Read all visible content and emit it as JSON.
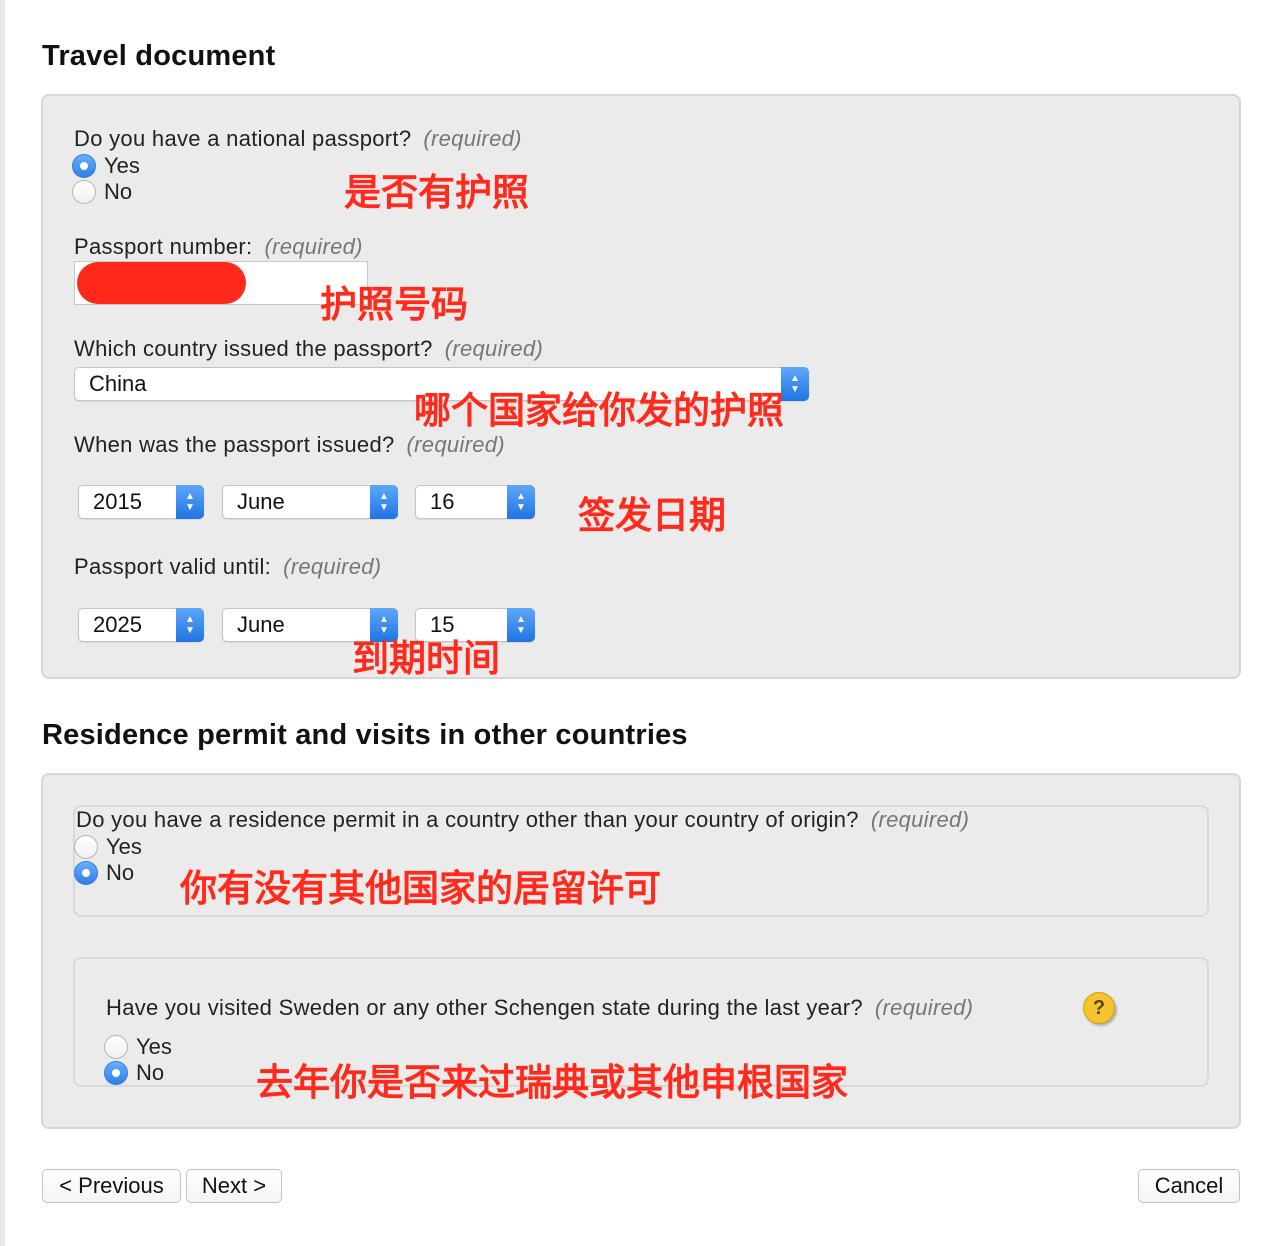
{
  "travel_document": {
    "title": "Travel document",
    "required_label": "(required)",
    "national_passport": {
      "question": "Do you have a national passport?",
      "yes": "Yes",
      "no": "No",
      "selected": "Yes",
      "annotation": "是否有护照"
    },
    "passport_number": {
      "question": "Passport number:",
      "annotation": "护照号码"
    },
    "issuing_country": {
      "question": "Which country issued the passport?",
      "value": "China",
      "annotation": "哪个国家给你发的护照"
    },
    "issue_date": {
      "question": "When was the passport issued?",
      "year": "2015",
      "month": "June",
      "day": "16",
      "annotation": "签发日期"
    },
    "valid_until": {
      "question": "Passport valid until:",
      "year": "2025",
      "month": "June",
      "day": "15",
      "annotation": "到期时间"
    }
  },
  "residence": {
    "title": "Residence permit and visits in other countries",
    "permit": {
      "question": "Do you have a residence permit in a country other than your country of origin?",
      "yes": "Yes",
      "no": "No",
      "selected": "No",
      "annotation": "你有没有其他国家的居留许可"
    },
    "schengen_visit": {
      "question": "Have you visited Sweden or any other Schengen state during the last year?",
      "yes": "Yes",
      "no": "No",
      "selected": "No",
      "help_icon": "?",
      "annotation": "去年你是否来过瑞典或其他申根国家"
    }
  },
  "nav": {
    "previous": "< Previous",
    "next": "Next >",
    "cancel": "Cancel"
  },
  "colors": {
    "annotation": "#ff2a1c",
    "radio_selected": "#2f7fe6",
    "panel_bg": "#ebebeb"
  }
}
